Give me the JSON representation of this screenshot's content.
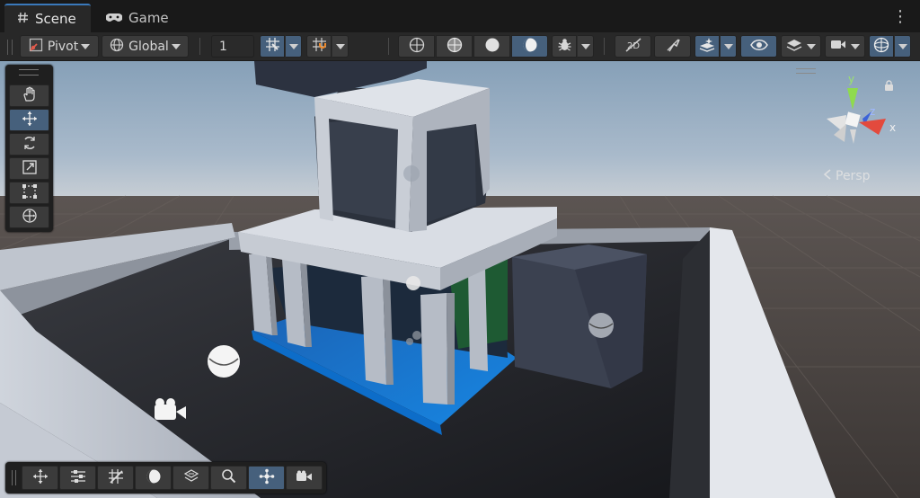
{
  "tabs": [
    {
      "label": "Scene",
      "icon": "hash-icon",
      "active": true
    },
    {
      "label": "Game",
      "icon": "gamepad-icon",
      "active": false
    }
  ],
  "toolbar": {
    "pivot_label": "Pivot",
    "global_label": "Global",
    "grid_snap_value": "1",
    "colors": {
      "active": "#46607c",
      "button": "#3b3b3b",
      "toolbar_bg": "#282828"
    }
  },
  "viewport": {
    "camera_projection_label": "Persp",
    "axes": {
      "x": "x",
      "y": "y",
      "z": "z"
    }
  },
  "tools_palette": [
    "view-tool",
    "move-tool",
    "rotate-tool",
    "scale-tool",
    "rect-tool",
    "transform-tool"
  ],
  "tools_palette_selected": "move-tool",
  "bottom_overlay": [
    "move-icon",
    "sliders-icon",
    "grid-icon",
    "shading-icon",
    "layers-icon",
    "search-icon",
    "nodes-icon",
    "camera-icon"
  ]
}
